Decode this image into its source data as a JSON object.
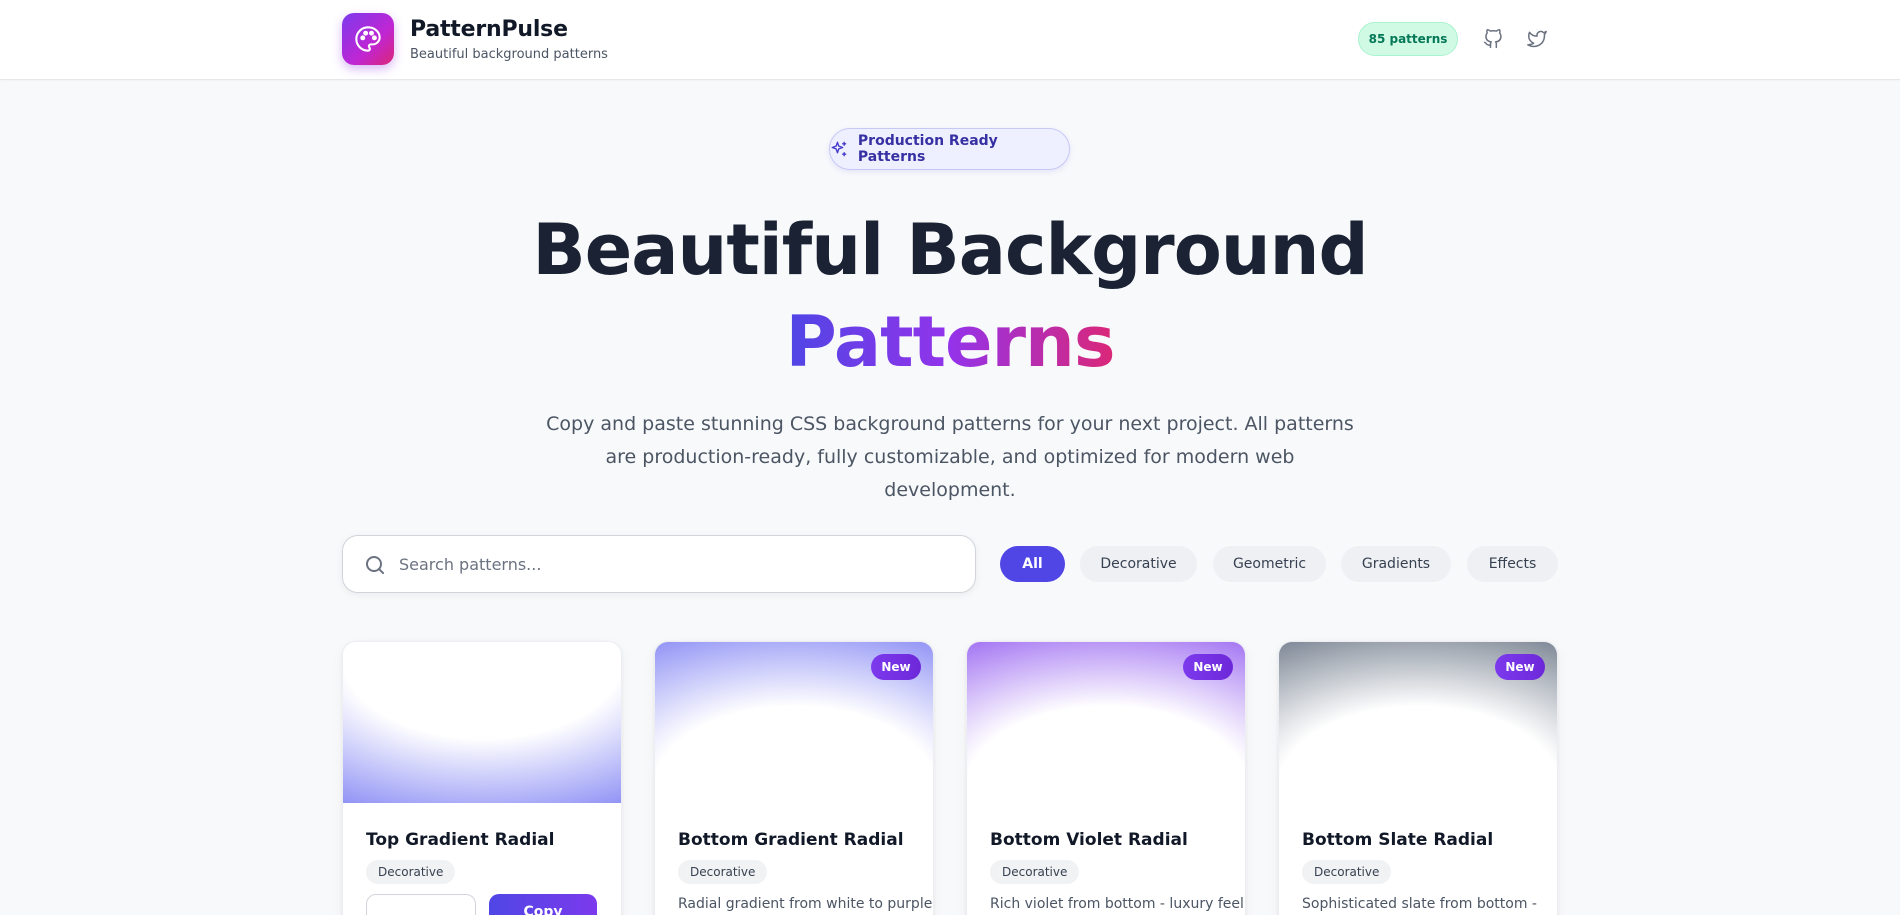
{
  "header": {
    "brand_name": "PatternPulse",
    "brand_tagline": "Beautiful background patterns",
    "pattern_count": "85 patterns",
    "icons": [
      "palette-icon",
      "github-icon",
      "twitter-icon"
    ]
  },
  "hero": {
    "badge_label": "Production Ready Patterns",
    "title_line1": "Beautiful Background",
    "title_line2": "Patterns",
    "description_line1": "Copy and paste stunning CSS background patterns for your next project. All patterns",
    "description_line2": "are production-ready, fully customizable, and optimized for modern web development."
  },
  "search": {
    "placeholder": "Search patterns...",
    "value": ""
  },
  "filters": [
    {
      "label": "All",
      "active": true
    },
    {
      "label": "Decorative",
      "active": false
    },
    {
      "label": "Geometric",
      "active": false
    },
    {
      "label": "Gradients",
      "active": false
    },
    {
      "label": "Effects",
      "active": false
    }
  ],
  "cards": [
    {
      "title": "Top Gradient Radial",
      "category": "Decorative",
      "badge": "",
      "description": "",
      "copy_label": "Copy"
    },
    {
      "title": "Bottom Gradient Radial",
      "category": "Decorative",
      "badge": "New",
      "description": "Radial gradient from white to purple"
    },
    {
      "title": "Bottom Violet Radial",
      "category": "Decorative",
      "badge": "New",
      "description": "Rich violet from bottom - luxury feel"
    },
    {
      "title": "Bottom Slate Radial",
      "category": "Decorative",
      "badge": "New",
      "description": "Sophisticated slate from bottom -"
    }
  ],
  "colors": {
    "accent": "#4f46e5",
    "brand_gradient": [
      "#7c3aed",
      "#db2777"
    ],
    "count_badge_bg": "#d1fae5",
    "count_badge_text": "#047857"
  }
}
